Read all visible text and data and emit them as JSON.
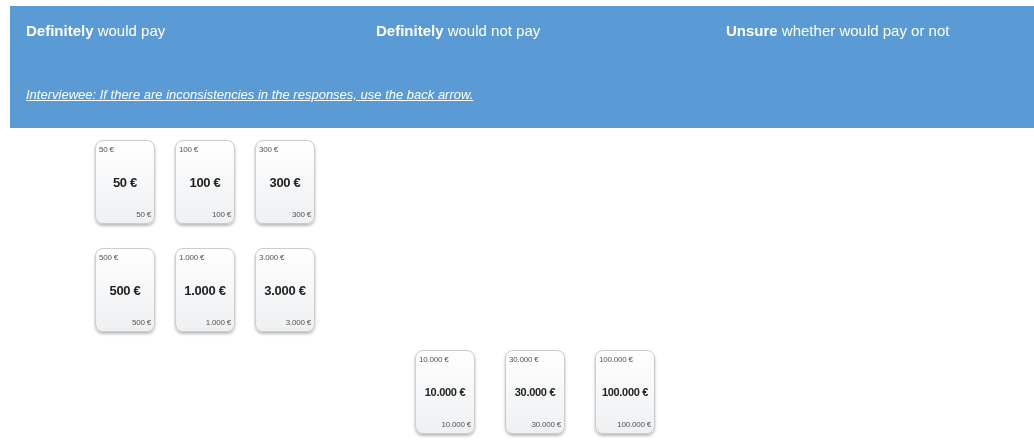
{
  "categories": [
    {
      "label": "**Definitely** would pay"
    },
    {
      "label": "**Definitely** would not pay"
    },
    {
      "label": "**Unsure** whether would pay or not"
    }
  ],
  "instruction": "Interviewee: If there are inconsistencies in the responses, use the back arrow.",
  "card_rows": [
    {
      "cards": [
        {
          "corner_top": "50 €",
          "amount": "50 €",
          "corner_bottom": "50 €"
        },
        {
          "corner_top": "100 €",
          "amount": "100 €",
          "corner_bottom": "100 €"
        },
        {
          "corner_top": "300 €",
          "amount": "300 €",
          "corner_bottom": "300 €"
        }
      ]
    },
    {
      "cards": [
        {
          "corner_top": "500 €",
          "amount": "500 €",
          "corner_bottom": "500 €"
        },
        {
          "corner_top": "1.000 €",
          "amount": "1.000 €",
          "corner_bottom": "1.000 €"
        },
        {
          "corner_top": "3.000 €",
          "amount": "3.000 €",
          "corner_bottom": "3.000 €"
        }
      ]
    },
    {
      "cards": [
        {
          "corner_top": "10.000 €",
          "amount": "10.000 €",
          "corner_bottom": "10.000 €"
        },
        {
          "corner_top": "30.000 €",
          "amount": "30.000 €",
          "corner_bottom": "30.000 €"
        },
        {
          "corner_top": "100.000 €",
          "amount": "100.000 €",
          "corner_bottom": "100.000 €"
        }
      ]
    }
  ]
}
